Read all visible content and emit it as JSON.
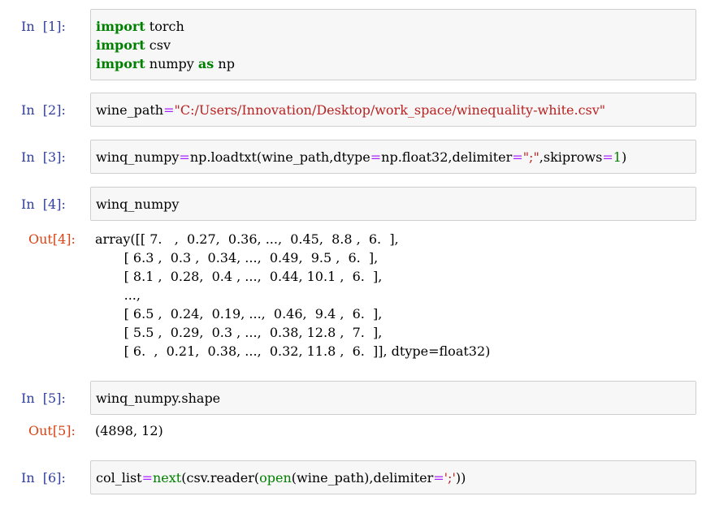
{
  "cells": [
    {
      "prompt": "In  [1]:",
      "lines": [
        [
          {
            "t": "import",
            "c": "kw"
          },
          {
            "t": " torch",
            "c": ""
          }
        ],
        [
          {
            "t": "import",
            "c": "kw"
          },
          {
            "t": " csv",
            "c": ""
          }
        ],
        [
          {
            "t": "import",
            "c": "kw"
          },
          {
            "t": " numpy ",
            "c": ""
          },
          {
            "t": "as",
            "c": "kw"
          },
          {
            "t": " np",
            "c": ""
          }
        ]
      ]
    },
    {
      "prompt": "In  [2]:",
      "lines": [
        [
          {
            "t": "wine_path",
            "c": ""
          },
          {
            "t": "=",
            "c": "op"
          },
          {
            "t": "\"C:/Users/Innovation/Desktop/work_space/winequality-white.csv\"",
            "c": "str"
          }
        ]
      ]
    },
    {
      "prompt": "In  [3]:",
      "lines": [
        [
          {
            "t": "winq_numpy",
            "c": ""
          },
          {
            "t": "=",
            "c": "op"
          },
          {
            "t": "np.loadtxt(wine_path,dtype",
            "c": ""
          },
          {
            "t": "=",
            "c": "op"
          },
          {
            "t": "np.float32,delimiter",
            "c": ""
          },
          {
            "t": "=",
            "c": "op"
          },
          {
            "t": "\";\"",
            "c": "str"
          },
          {
            "t": ",skiprows",
            "c": ""
          },
          {
            "t": "=",
            "c": "op"
          },
          {
            "t": "1",
            "c": "num"
          },
          {
            "t": ")",
            "c": ""
          }
        ]
      ]
    },
    {
      "prompt": "In  [4]:",
      "lines": [
        [
          {
            "t": "winq_numpy",
            "c": ""
          }
        ]
      ],
      "out_prompt": "Out[4]:",
      "output_lines": [
        "array([[ 7.   ,  0.27,  0.36, ...,  0.45,  8.8 ,  6.  ],",
        "       [ 6.3 ,  0.3 ,  0.34, ...,  0.49,  9.5 ,  6.  ],",
        "       [ 8.1 ,  0.28,  0.4 , ...,  0.44, 10.1 ,  6.  ],",
        "       ...,",
        "       [ 6.5 ,  0.24,  0.19, ...,  0.46,  9.4 ,  6.  ],",
        "       [ 5.5 ,  0.29,  0.3 , ...,  0.38, 12.8 ,  7.  ],",
        "       [ 6.  ,  0.21,  0.38, ...,  0.32, 11.8 ,  6.  ]], dtype=float32)"
      ]
    },
    {
      "prompt": "In  [5]:",
      "lines": [
        [
          {
            "t": "winq_numpy.shape",
            "c": ""
          }
        ]
      ],
      "out_prompt": "Out[5]:",
      "output_lines": [
        "(4898, 12)"
      ]
    },
    {
      "prompt": "In  [6]:",
      "lines": [
        [
          {
            "t": "col_list",
            "c": ""
          },
          {
            "t": "=",
            "c": "op"
          },
          {
            "t": "next",
            "c": "bi"
          },
          {
            "t": "(csv.reader(",
            "c": ""
          },
          {
            "t": "open",
            "c": "bi"
          },
          {
            "t": "(wine_path),delimiter",
            "c": ""
          },
          {
            "t": "=",
            "c": "op"
          },
          {
            "t": "';'",
            "c": "str"
          },
          {
            "t": "))",
            "c": ""
          }
        ]
      ]
    }
  ]
}
